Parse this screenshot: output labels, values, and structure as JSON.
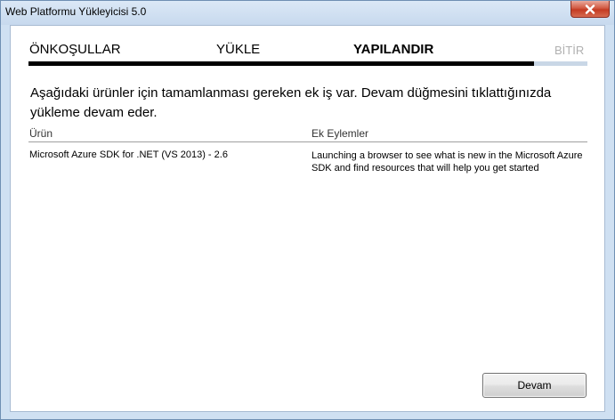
{
  "window": {
    "title": "Web Platformu Yükleyicisi 5.0"
  },
  "steps": [
    {
      "label": "ÖNKOŞULLAR",
      "state": "done"
    },
    {
      "label": "YÜKLE",
      "state": "done"
    },
    {
      "label": "YAPILANDIR",
      "state": "current"
    },
    {
      "label": "BİTİR",
      "state": "pending"
    }
  ],
  "progress": {
    "fraction": 0.905
  },
  "message": "Aşağıdaki ürünler için tamamlanması gereken ek iş var. Devam düğmesini tıklattığınızda yükleme devam eder.",
  "table": {
    "headers": [
      "Ürün",
      "Ek Eylemler"
    ],
    "rows": [
      {
        "product": "Microsoft Azure SDK for .NET (VS 2013) - 2.6",
        "action": "Launching a browser to see what is new in the Microsoft Azure SDK and find resources that will help you get started"
      }
    ]
  },
  "buttons": {
    "continue": "Devam"
  },
  "colors": {
    "frame": "#cfe0f2",
    "close_button": "#c43b22",
    "progress_fill": "#000000",
    "progress_track": "#c9d7e6",
    "pending_step": "#b0b0b0"
  },
  "icons": {
    "close": "close-icon"
  }
}
